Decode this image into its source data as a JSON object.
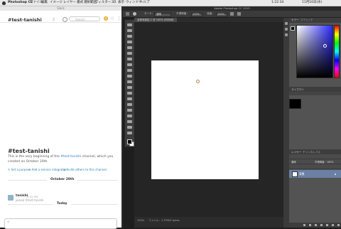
{
  "menubar": {
    "app": "Photoshop CC",
    "items": [
      "ファイル",
      "編集",
      "イメージ",
      "レイヤー",
      "書式",
      "選択範囲",
      "フィルター",
      "3D",
      "表示",
      "ウィンドウ",
      "ヘルプ"
    ],
    "clock": "1:22:34",
    "date": "11月16日(水)"
  },
  "slack": {
    "window_title": "Slack",
    "channel": "#test-tanishi",
    "member_count": "2",
    "search_placeholder": "Search",
    "intro_title": "#test-tanishi",
    "intro_pre": "This is the very beginning of the ",
    "intro_link": "#test-tanishi",
    "intro_post": " channel, which you created on October 20th.",
    "actions": [
      "Set a purpose",
      "Add a service integration",
      "Invite others to this channel"
    ],
    "day1": "October 20th",
    "message": {
      "user": "tanishi",
      "time": "4:41 PM",
      "text": "joined #test-tanishi"
    },
    "day2": "Today"
  },
  "photoshop": {
    "title": "Adobe Photoshop CC 2015",
    "options": [
      "モード：",
      "通常",
      "不透明度：",
      "100%",
      "流量：",
      "100%"
    ],
    "doc_tab": "名称未設定-1 @ 100% (RGB/8)",
    "zoom": "100%",
    "status": "ファイル：1.37M/0 bytes",
    "panels": {
      "color_tabs": [
        "カラー",
        "スウォッチ"
      ],
      "library_title": "ライブラリ",
      "layers_tabs": [
        "レイヤー",
        "チャンネル",
        "パス"
      ],
      "layer_mode": "通常",
      "layer_opacity": "不透明度：100%",
      "layer_name": "背景"
    }
  }
}
